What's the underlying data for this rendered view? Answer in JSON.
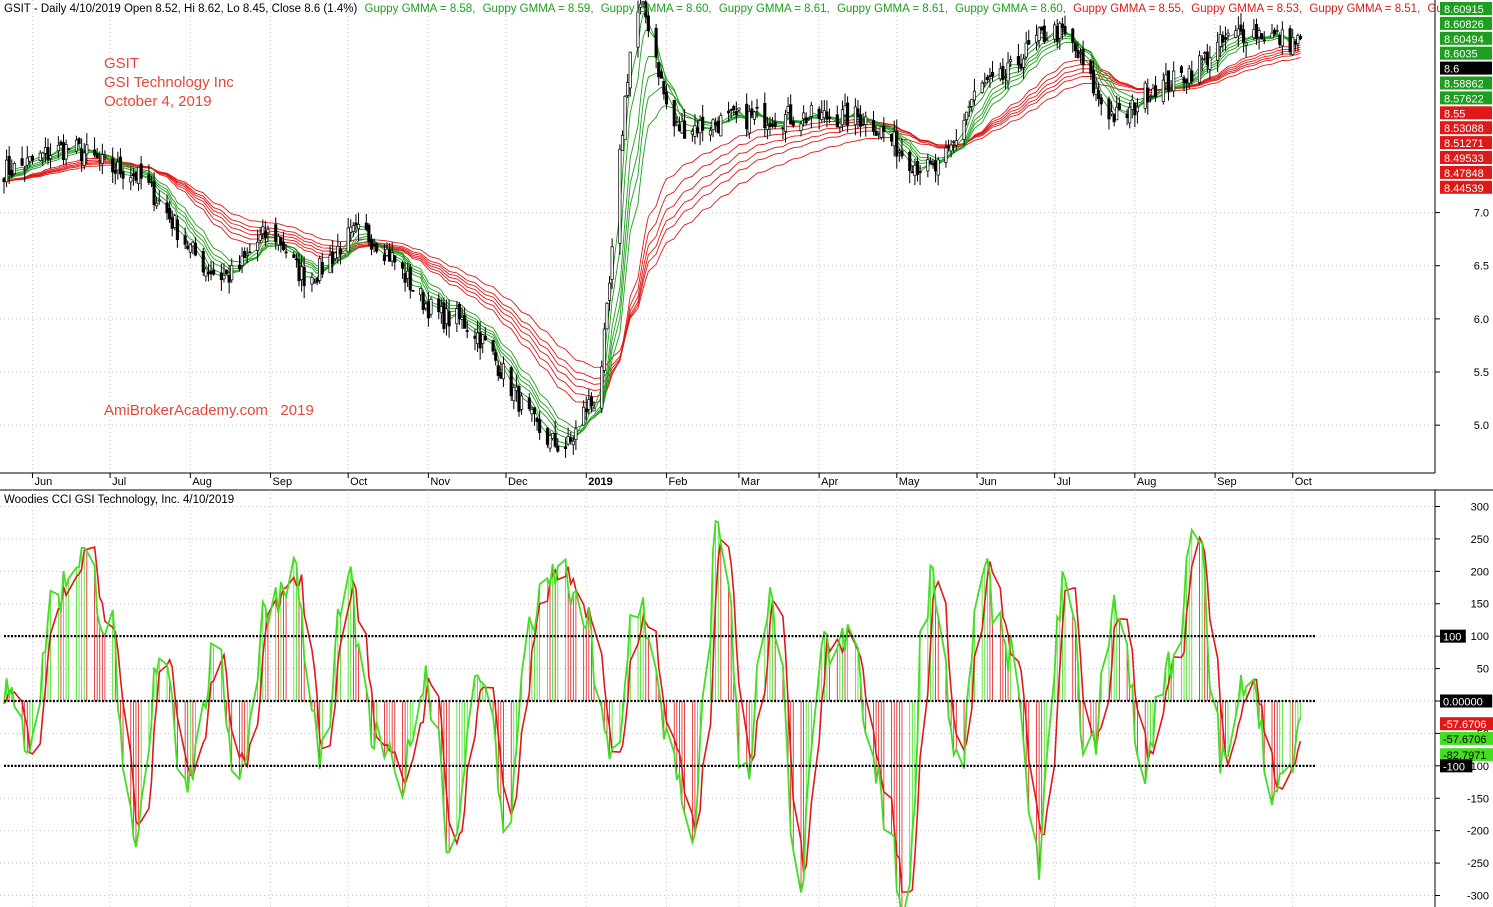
{
  "price_panel": {
    "header": {
      "symbol_text": "GSIT - Daily 4/10/2019 Open 8.52, Hi 8.62, Lo 8.45, Close 8.6 (1.4%)",
      "gmma_labels_green": [
        "Guppy GMMA = 8.58,",
        "Guppy GMMA = 8.59,",
        "Guppy GMMA = 8.60,",
        "Guppy GMMA = 8.61,",
        "Guppy GMMA = 8.61,",
        "Guppy GMMA = 8.60,"
      ],
      "gmma_labels_red": [
        "Guppy GMMA = 8.55,",
        "Guppy GMMA = 8.53,",
        "Guppy GMMA = 8.51,",
        "Gu"
      ]
    },
    "annotation": {
      "ticker": "GSIT",
      "company": "GSI Technology Inc",
      "date": "October 4, 2019",
      "watermark": "AmiBrokerAcademy.com   2019",
      "color": "#e8463a"
    },
    "y_ticks": [
      "7.0",
      "6.5",
      "6.0",
      "5.5",
      "5.0"
    ],
    "right_labels": [
      {
        "text": "8.60915",
        "color": "#1e9e1e"
      },
      {
        "text": "8.60826",
        "color": "#1e9e1e"
      },
      {
        "text": "8.60494",
        "color": "#1e9e1e"
      },
      {
        "text": "8.6035",
        "color": "#1e9e1e"
      },
      {
        "text": "8.6",
        "color": "#000000"
      },
      {
        "text": "8.58862",
        "color": "#1e9e1e"
      },
      {
        "text": "8.57622",
        "color": "#1e9e1e"
      },
      {
        "text": "8.55",
        "color": "#e01818"
      },
      {
        "text": "8.53088",
        "color": "#e01818"
      },
      {
        "text": "8.51271",
        "color": "#e01818"
      },
      {
        "text": "8.49533",
        "color": "#e01818"
      },
      {
        "text": "8.47848",
        "color": "#e01818"
      },
      {
        "text": "8.44539",
        "color": "#e01818"
      }
    ],
    "x_labels": [
      "Jun",
      "Jul",
      "Aug",
      "Sep",
      "Oct",
      "Nov",
      "Dec",
      "2019",
      "Feb",
      "Mar",
      "Apr",
      "May",
      "Jun",
      "Jul",
      "Aug",
      "Sep",
      "Oct"
    ]
  },
  "cci_panel": {
    "title": "Woodies CCI  GSI Technology, Inc. 4/10/2019",
    "y_ticks": [
      "300",
      "250",
      "200",
      "150",
      "100",
      "50",
      "0.00000",
      "-50",
      "-100",
      "-150",
      "-200",
      "-250",
      "-300"
    ],
    "right_labels": [
      {
        "text": "100",
        "bg": "#000000",
        "fg": "#ffffff"
      },
      {
        "text": "0.00000",
        "bg": "#000000",
        "fg": "#ffffff"
      },
      {
        "text": "-57.6706",
        "bg": "#e01818",
        "fg": "#ffffff"
      },
      {
        "text": "-57.6706",
        "bg": "#44dd22",
        "fg": "#000000"
      },
      {
        "text": "-82.7971",
        "bg": "#44dd22",
        "fg": "#000000"
      },
      {
        "text": "-100",
        "bg": "#000000",
        "fg": "#ffffff"
      }
    ]
  },
  "chart_data": [
    {
      "type": "candlestick",
      "title": "GSIT - Daily 4/10/2019 Open 8.52, Hi 8.62, Lo 8.45, Close 8.6 (1.4%)",
      "x_type": "date",
      "x_range": [
        "2018-05-21",
        "2019-10-10"
      ],
      "ylim": [
        4.55,
        9.0
      ],
      "price_key_points": {
        "x": [
          "2018-05-21",
          "2018-06-15",
          "2018-07-05",
          "2018-08-15",
          "2018-09-01",
          "2018-09-15",
          "2018-10-05",
          "2018-11-10",
          "2018-12-24",
          "2019-01-03",
          "2019-01-22",
          "2019-02-05",
          "2019-03-10",
          "2019-04-15",
          "2019-05-15",
          "2019-06-05",
          "2019-07-01",
          "2019-07-26",
          "2019-08-10",
          "2019-09-15",
          "2019-10-04"
        ],
        "y": [
          7.4,
          7.6,
          7.4,
          6.4,
          6.8,
          6.4,
          6.8,
          6.0,
          4.8,
          5.2,
          8.9,
          7.8,
          7.9,
          7.9,
          7.4,
          8.2,
          8.7,
          7.9,
          8.2,
          8.7,
          8.6
        ]
      },
      "series": [
        {
          "name": "Guppy GMMA short-term (green)",
          "last_values": [
            8.60915,
            8.60826,
            8.60494,
            8.6035,
            8.58862,
            8.57622
          ]
        },
        {
          "name": "Guppy GMMA long-term (red)",
          "last_values": [
            8.55,
            8.53088,
            8.51271,
            8.49533,
            8.47848,
            8.44539
          ]
        }
      ],
      "last_close": 8.6
    },
    {
      "type": "line",
      "title": "Woodies CCI  GSI Technology, Inc. 4/10/2019",
      "ylim": [
        -310,
        310
      ],
      "reference_lines": [
        100,
        0,
        -100
      ],
      "series": [
        {
          "name": "CCI (green)",
          "color": "#44dd22",
          "last_value": -57.6706,
          "key_points": [
            20,
            -60,
            160,
            230,
            120,
            -240,
            80,
            -120,
            60,
            -110,
            150,
            200,
            -90,
            180,
            -60,
            -120,
            40,
            -230,
            60,
            -180,
            130,
            200,
            120,
            -100,
            160,
            -40,
            -220,
            280,
            -100,
            150,
            -270,
            80,
            90,
            -130,
            -310,
            210,
            -100,
            190,
            80,
            -250,
            180,
            -80,
            150,
            -100,
            60,
            250,
            -100,
            50,
            -150,
            -57.7
          ]
        },
        {
          "name": "Turbo CCI (red)",
          "color": "#e01818",
          "last_value": -82.7971
        }
      ]
    }
  ]
}
